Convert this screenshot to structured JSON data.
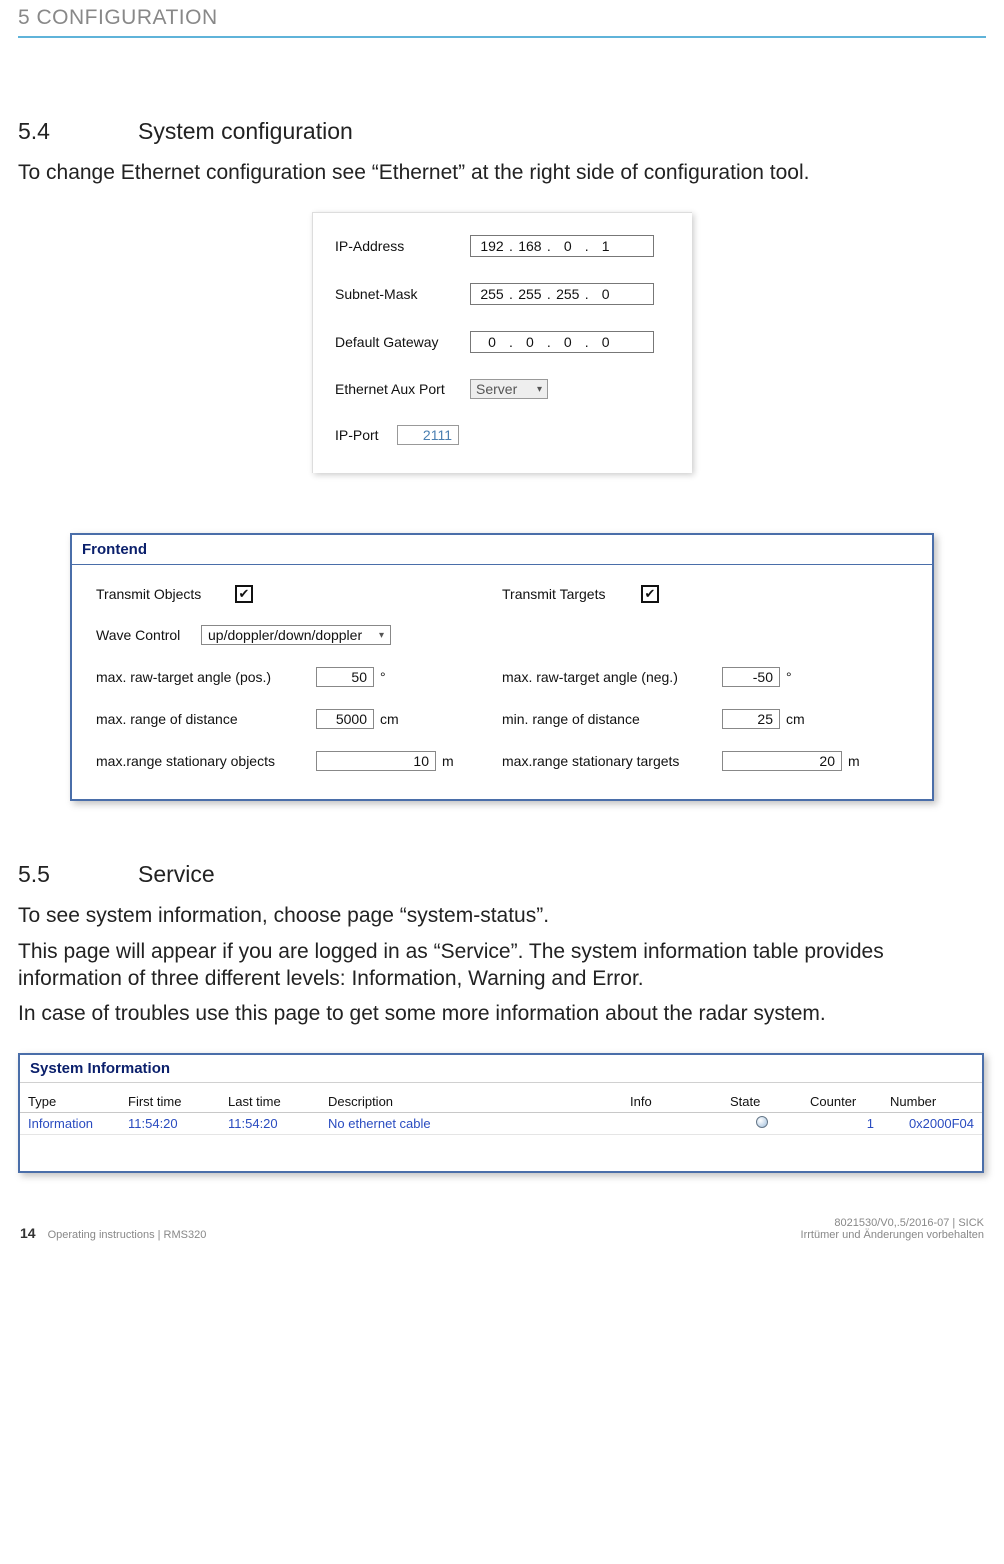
{
  "header": {
    "chapter": "5 CONFIGURATION"
  },
  "section54": {
    "num": "5.4",
    "title": "System configuration",
    "intro": "To change Ethernet configuration see “Ethernet” at the right side of configuration tool."
  },
  "ethernet": {
    "ip_label": "IP-Address",
    "ip": [
      "192",
      "168",
      "0",
      "1"
    ],
    "mask_label": "Subnet-Mask",
    "mask": [
      "255",
      "255",
      "255",
      "0"
    ],
    "gw_label": "Default Gateway",
    "gw": [
      "0",
      "0",
      "0",
      "0"
    ],
    "aux_label": "Ethernet Aux Port",
    "aux_value": "Server",
    "port_label": "IP-Port",
    "port_value": "2111"
  },
  "frontend": {
    "title": "Frontend",
    "transmit_objects_label": "Transmit Objects",
    "transmit_objects_checked": "✔",
    "transmit_targets_label": "Transmit Targets",
    "transmit_targets_checked": "✔",
    "wave_control_label": "Wave Control",
    "wave_control_value": "up/doppler/down/doppler",
    "max_angle_pos_label": "max. raw-target angle (pos.)",
    "max_angle_pos_value": "50",
    "deg": "°",
    "max_angle_neg_label": "max. raw-target angle (neg.)",
    "max_angle_neg_value": "-50",
    "max_dist_label": "max. range of distance",
    "max_dist_value": "5000",
    "cm": "cm",
    "min_dist_label": "min. range of distance",
    "min_dist_value": "25",
    "max_stat_obj_label": "max.range stationary objects",
    "max_stat_obj_value": "10",
    "m": "m",
    "max_stat_tgt_label": "max.range stationary targets",
    "max_stat_tgt_value": "20"
  },
  "section55": {
    "num": "5.5",
    "title": "Service",
    "p1": "To see system information, choose page “system-status”.",
    "p2": "This page will appear if you are logged in as “Service”. The system information table provides information of three different levels: Information, Warning and Error.",
    "p3": "In case of troubles use this page to get some more information about the radar system."
  },
  "sysinfo": {
    "title": "System Information",
    "headers": {
      "type": "Type",
      "first": "First time",
      "last": "Last time",
      "desc": "Description",
      "info": "Info",
      "state": "State",
      "counter": "Counter",
      "number": "Number"
    },
    "row": {
      "type": "Information",
      "first": "11:54:20",
      "last": "11:54:20",
      "desc": "No ethernet cable",
      "info": "",
      "counter": "1",
      "number": "0x2000F04"
    }
  },
  "footer": {
    "page_num": "14",
    "left": "Operating instructions | RMS320",
    "right1": "8021530/V0,.5/2016-07 | SICK",
    "right2": "Irrtümer und Änderungen vorbehalten"
  }
}
